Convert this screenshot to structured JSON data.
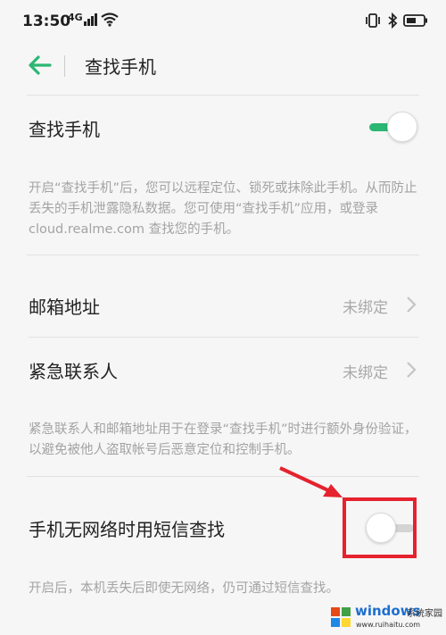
{
  "status": {
    "time": "13:50",
    "signal": "4G"
  },
  "header": {
    "title": "查找手机"
  },
  "find_phone": {
    "title": "查找手机",
    "enabled": true,
    "desc": "开启“查找手机”后，您可以远程定位、锁死或抹除此手机。从而防止丢失的手机泄露隐私数据。您可使用“查找手机”应用，或登录 cloud.realme.com 查找您的手机。"
  },
  "email": {
    "title": "邮箱地址",
    "value": "未绑定"
  },
  "emergency": {
    "title": "紧急联系人",
    "value": "未绑定",
    "desc": "紧急联系人和邮箱地址用于在登录“查找手机”时进行额外身份验证，以避免被他人盗取帐号后恶意定位和控制手机。"
  },
  "sms_find": {
    "title": "手机无网络时用短信查找",
    "enabled": false,
    "desc": "开启后，本机丢失后即使无网络，仍可通过短信查找。"
  },
  "watermark": {
    "brand": "windows",
    "sub": "系统家园",
    "url": "www.ruihaitu.com"
  },
  "colors": {
    "accent": "#2bb673",
    "annotation": "#e5222e"
  }
}
